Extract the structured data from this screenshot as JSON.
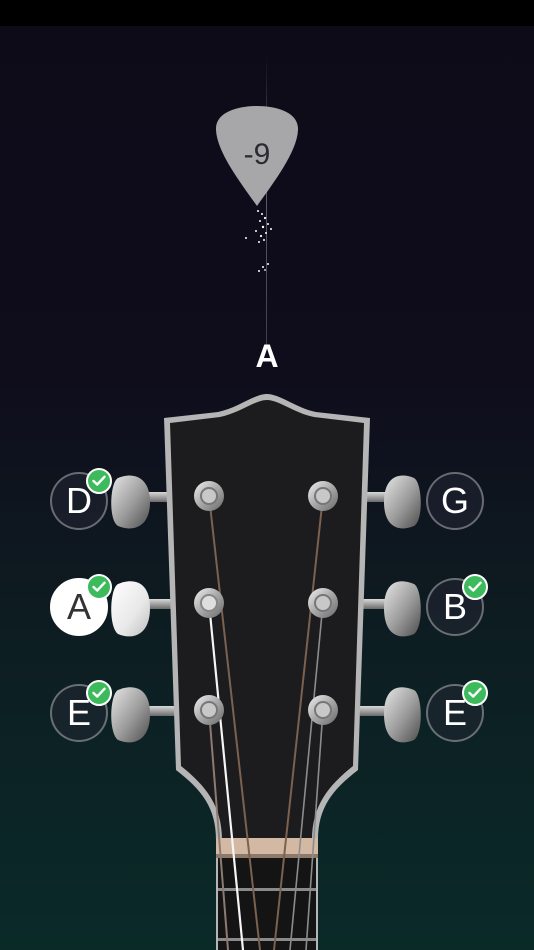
{
  "tuner": {
    "cents_offset": "-9",
    "current_note": "A",
    "pick_color": "#a7a7a9"
  },
  "strings_left": [
    {
      "note": "D",
      "tuned": true,
      "selected": false
    },
    {
      "note": "A",
      "tuned": true,
      "selected": true
    },
    {
      "note": "E",
      "tuned": true,
      "selected": false
    }
  ],
  "strings_right": [
    {
      "note": "G",
      "tuned": false,
      "selected": false
    },
    {
      "note": "B",
      "tuned": true,
      "selected": false
    },
    {
      "note": "E",
      "tuned": true,
      "selected": false
    }
  ],
  "colors": {
    "tuned_badge": "#3dbb5c",
    "selected_peg": "#ffffff"
  }
}
